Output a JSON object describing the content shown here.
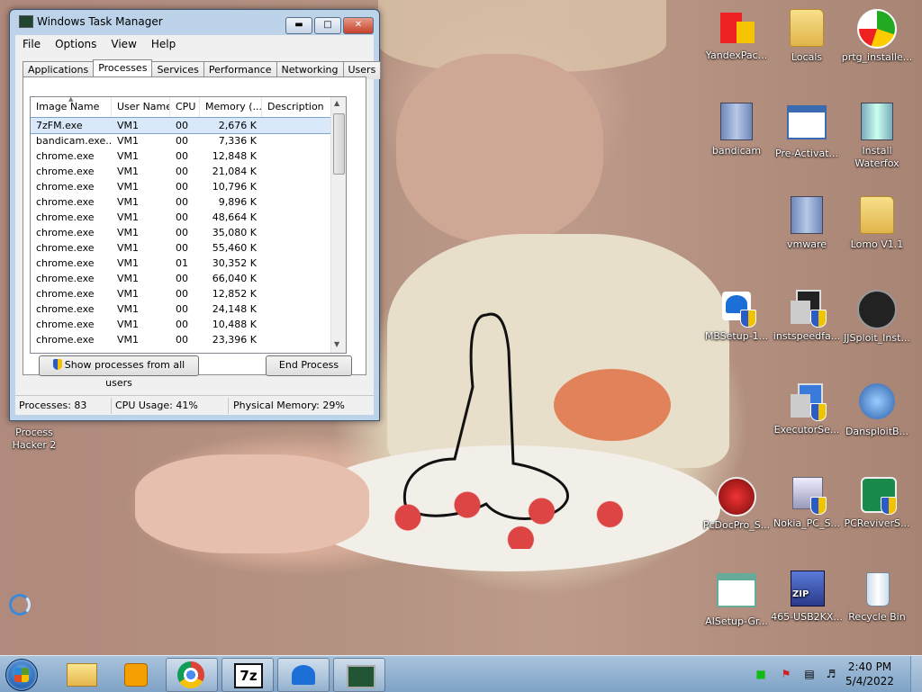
{
  "window": {
    "title": "Windows Task Manager",
    "menu": [
      "File",
      "Options",
      "View",
      "Help"
    ],
    "tabs": [
      "Applications",
      "Processes",
      "Services",
      "Performance",
      "Networking",
      "Users"
    ],
    "active_tab": "Processes",
    "columns": [
      "Image Name",
      "User Name",
      "CPU",
      "Memory (...",
      "Description"
    ],
    "processes": [
      {
        "name": "7zFM.exe",
        "user": "VM1",
        "cpu": "00",
        "mem": "2,676 K",
        "desc": ""
      },
      {
        "name": "bandicam.exe...",
        "user": "VM1",
        "cpu": "00",
        "mem": "7,336 K",
        "desc": ""
      },
      {
        "name": "chrome.exe",
        "user": "VM1",
        "cpu": "00",
        "mem": "12,848 K",
        "desc": ""
      },
      {
        "name": "chrome.exe",
        "user": "VM1",
        "cpu": "00",
        "mem": "21,084 K",
        "desc": ""
      },
      {
        "name": "chrome.exe",
        "user": "VM1",
        "cpu": "00",
        "mem": "10,796 K",
        "desc": ""
      },
      {
        "name": "chrome.exe",
        "user": "VM1",
        "cpu": "00",
        "mem": "9,896 K",
        "desc": ""
      },
      {
        "name": "chrome.exe",
        "user": "VM1",
        "cpu": "00",
        "mem": "48,664 K",
        "desc": ""
      },
      {
        "name": "chrome.exe",
        "user": "VM1",
        "cpu": "00",
        "mem": "35,080 K",
        "desc": ""
      },
      {
        "name": "chrome.exe",
        "user": "VM1",
        "cpu": "00",
        "mem": "55,460 K",
        "desc": ""
      },
      {
        "name": "chrome.exe",
        "user": "VM1",
        "cpu": "01",
        "mem": "30,352 K",
        "desc": ""
      },
      {
        "name": "chrome.exe",
        "user": "VM1",
        "cpu": "00",
        "mem": "66,040 K",
        "desc": ""
      },
      {
        "name": "chrome.exe",
        "user": "VM1",
        "cpu": "00",
        "mem": "12,852 K",
        "desc": ""
      },
      {
        "name": "chrome.exe",
        "user": "VM1",
        "cpu": "00",
        "mem": "24,148 K",
        "desc": ""
      },
      {
        "name": "chrome.exe",
        "user": "VM1",
        "cpu": "00",
        "mem": "10,488 K",
        "desc": ""
      },
      {
        "name": "chrome.exe",
        "user": "VM1",
        "cpu": "00",
        "mem": "23,396 K",
        "desc": ""
      }
    ],
    "show_all_label": "Show processes from all users",
    "end_process_label": "End Process",
    "status": {
      "processes": "Processes: 83",
      "cpu": "CPU Usage: 41%",
      "memory": "Physical Memory: 29%"
    }
  },
  "desktop_icons": {
    "yandex": "YandexPac...",
    "locals": "Locals",
    "prtg": "prtg_installe...",
    "bandicam": "bandicam",
    "preactivat": "Pre-Activat...",
    "waterfox_1": "Install",
    "waterfox_2": "Waterfox",
    "vmware": "vmware",
    "lomo": "Lomo V1.1",
    "mbsetup": "MBSetup-1...",
    "instspeed": "instspeedfa...",
    "jjsploit": "JJSploit_Inst...",
    "executor": "ExecutorSe...",
    "dansploit": "DansploitB...",
    "pcdocpro": "PcDocPro_S...",
    "nokia": "Nokia_PC_S...",
    "pcreviver": "PCReviverS...",
    "aisetup": "AISetup-Gr...",
    "usb2kx": "465-USB2KX...",
    "recycle": "Recycle Bin",
    "processhacker_1": "Process",
    "processhacker_2": "Hacker 2"
  },
  "taskbar": {
    "time": "2:40 PM",
    "date": "5/4/2022",
    "zip_label": "7z",
    "usb_zip_label": "ZIP"
  },
  "colors": {
    "title_bar": "#bcd3ea",
    "selection": "#d9e9f9",
    "taskbar": "#8fb0d0"
  }
}
